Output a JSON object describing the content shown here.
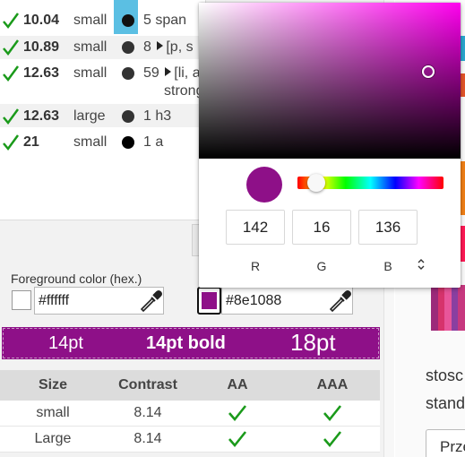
{
  "results": [
    {
      "ratio": "10.04",
      "size": "small",
      "dot": "#111111",
      "count": "5",
      "expand": false,
      "tags": "span",
      "tags2": ""
    },
    {
      "ratio": "10.89",
      "size": "small",
      "dot": "#333333",
      "count": "8",
      "expand": true,
      "tags": "[p, s",
      "tags2": ""
    },
    {
      "ratio": "12.63",
      "size": "small",
      "dot": "#333333",
      "count": "59",
      "expand": true,
      "tags": "[li, a",
      "tags2": "strong"
    },
    {
      "ratio": "12.63",
      "size": "large",
      "dot": "#333333",
      "count": "1",
      "expand": false,
      "tags": "h3",
      "tags2": ""
    },
    {
      "ratio": "21",
      "size": "small",
      "dot": "#000000",
      "count": "1",
      "expand": false,
      "tags": "a",
      "tags2": ""
    }
  ],
  "foreground": {
    "label": "Foreground color (hex.)",
    "value": "#ffffff"
  },
  "background": {
    "value": "#8e1088",
    "swatch_color": "#8e1088"
  },
  "preview": {
    "normal": "14pt",
    "bold": "14pt bold",
    "large": "18pt"
  },
  "table": {
    "headers": [
      "Size",
      "Contrast",
      "AA",
      "AAA"
    ],
    "rows": [
      {
        "size": "small",
        "contrast": "8.14",
        "aa": true,
        "aaa": true
      },
      {
        "size": "Large",
        "contrast": "8.14",
        "aa": true,
        "aaa": true
      }
    ]
  },
  "picker": {
    "r": "142",
    "g": "16",
    "b": "136",
    "r_label": "R",
    "g_label": "G",
    "b_label": "B",
    "hue_color": "#ff00ee",
    "current_color": "#8e1088"
  },
  "right": {
    "text1": "stosc",
    "text2": "stand",
    "button": "Prze"
  },
  "colors": {
    "check": "#1a9a1a",
    "accent": "#8e1088"
  }
}
